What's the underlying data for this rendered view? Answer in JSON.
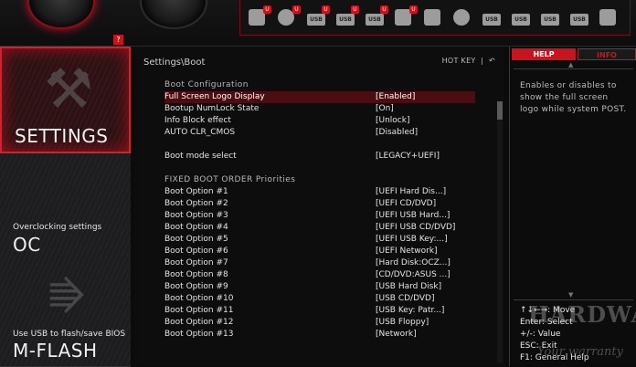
{
  "topbar": {
    "help_glyph": "?",
    "boot_devices": [
      {
        "icon": "hdd-icon",
        "label": "",
        "badge": "U"
      },
      {
        "icon": "disc-icon",
        "label": "",
        "badge": "U"
      },
      {
        "icon": "usb-icon",
        "label": "USB",
        "badge": "U"
      },
      {
        "icon": "usb-icon",
        "label": "USB",
        "badge": "U"
      },
      {
        "icon": "usb-key-icon",
        "label": "USB",
        "badge": "U"
      },
      {
        "icon": "network-icon",
        "label": "",
        "badge": "U"
      },
      {
        "icon": "hdd-icon",
        "label": "",
        "badge": ""
      },
      {
        "icon": "disc-icon",
        "label": "",
        "badge": ""
      },
      {
        "icon": "usb-icon",
        "label": "USB",
        "badge": ""
      },
      {
        "icon": "usb-icon",
        "label": "USB",
        "badge": ""
      },
      {
        "icon": "usb-key-icon",
        "label": "USB",
        "badge": ""
      },
      {
        "icon": "usb-icon",
        "label": "USB",
        "badge": ""
      },
      {
        "icon": "network-icon",
        "label": "",
        "badge": ""
      }
    ]
  },
  "sidebar": {
    "settings": {
      "label": "SETTINGS"
    },
    "oc": {
      "caption": "Overclocking settings",
      "label": "OC"
    },
    "mflash": {
      "caption": "Use USB to flash/save BIOS",
      "label": "M-FLASH"
    }
  },
  "main": {
    "breadcrumb": "Settings\\Boot",
    "hotkey": "HOT KEY",
    "hotkey_sep": "|",
    "back_glyph": "↶",
    "boot_config_header": "Boot  Configuration",
    "config_rows": [
      {
        "label": "Full Screen Logo Display",
        "value": "[Enabled]"
      },
      {
        "label": "Bootup NumLock State",
        "value": "[On]"
      },
      {
        "label": "Info Block effect",
        "value": "[Unlock]"
      },
      {
        "label": "AUTO CLR_CMOS",
        "value": "[Disabled]"
      }
    ],
    "boot_mode": {
      "label": "Boot mode select",
      "value": "[LEGACY+UEFI]"
    },
    "fixed_header": "FIXED  BOOT  ORDER  Priorities",
    "boot_options": [
      {
        "label": "Boot Option #1",
        "value": "[UEFI Hard Dis...]"
      },
      {
        "label": "Boot Option #2",
        "value": "[UEFI CD/DVD]"
      },
      {
        "label": "Boot Option #3",
        "value": "[UEFI USB Hard...]"
      },
      {
        "label": "Boot Option #4",
        "value": "[UEFI USB CD/DVD]"
      },
      {
        "label": "Boot Option #5",
        "value": "[UEFI USB Key:...]"
      },
      {
        "label": "Boot Option #6",
        "value": "[UEFI Network]"
      },
      {
        "label": "Boot Option #7",
        "value": "[Hard Disk:OCZ...]"
      },
      {
        "label": "Boot Option #8",
        "value": "[CD/DVD:ASUS    ...]"
      },
      {
        "label": "Boot Option #9",
        "value": "[USB Hard Disk]"
      },
      {
        "label": "Boot Option #10",
        "value": "[USB CD/DVD]"
      },
      {
        "label": "Boot Option #11",
        "value": "[USB Key: Patr...]"
      },
      {
        "label": "Boot Option #12",
        "value": "[USB Floppy]"
      },
      {
        "label": "Boot Option #13",
        "value": "[Network]"
      }
    ]
  },
  "help": {
    "tab_help": "HELP",
    "tab_info": "INFO",
    "description": "Enables or disables to show the full screen logo while system POST.",
    "keys": [
      "↑↓←→:  Move",
      "Enter:  Select",
      "+/-:  Value",
      "ESC:  Exit",
      "F1:  General  Help"
    ]
  },
  "watermark": {
    "line1": "HARDWARE",
    "line2": "Your warranty"
  },
  "colors": {
    "accent": "#c8141e",
    "selected_row": "#4a0d12",
    "background": "#0b0b0c"
  }
}
